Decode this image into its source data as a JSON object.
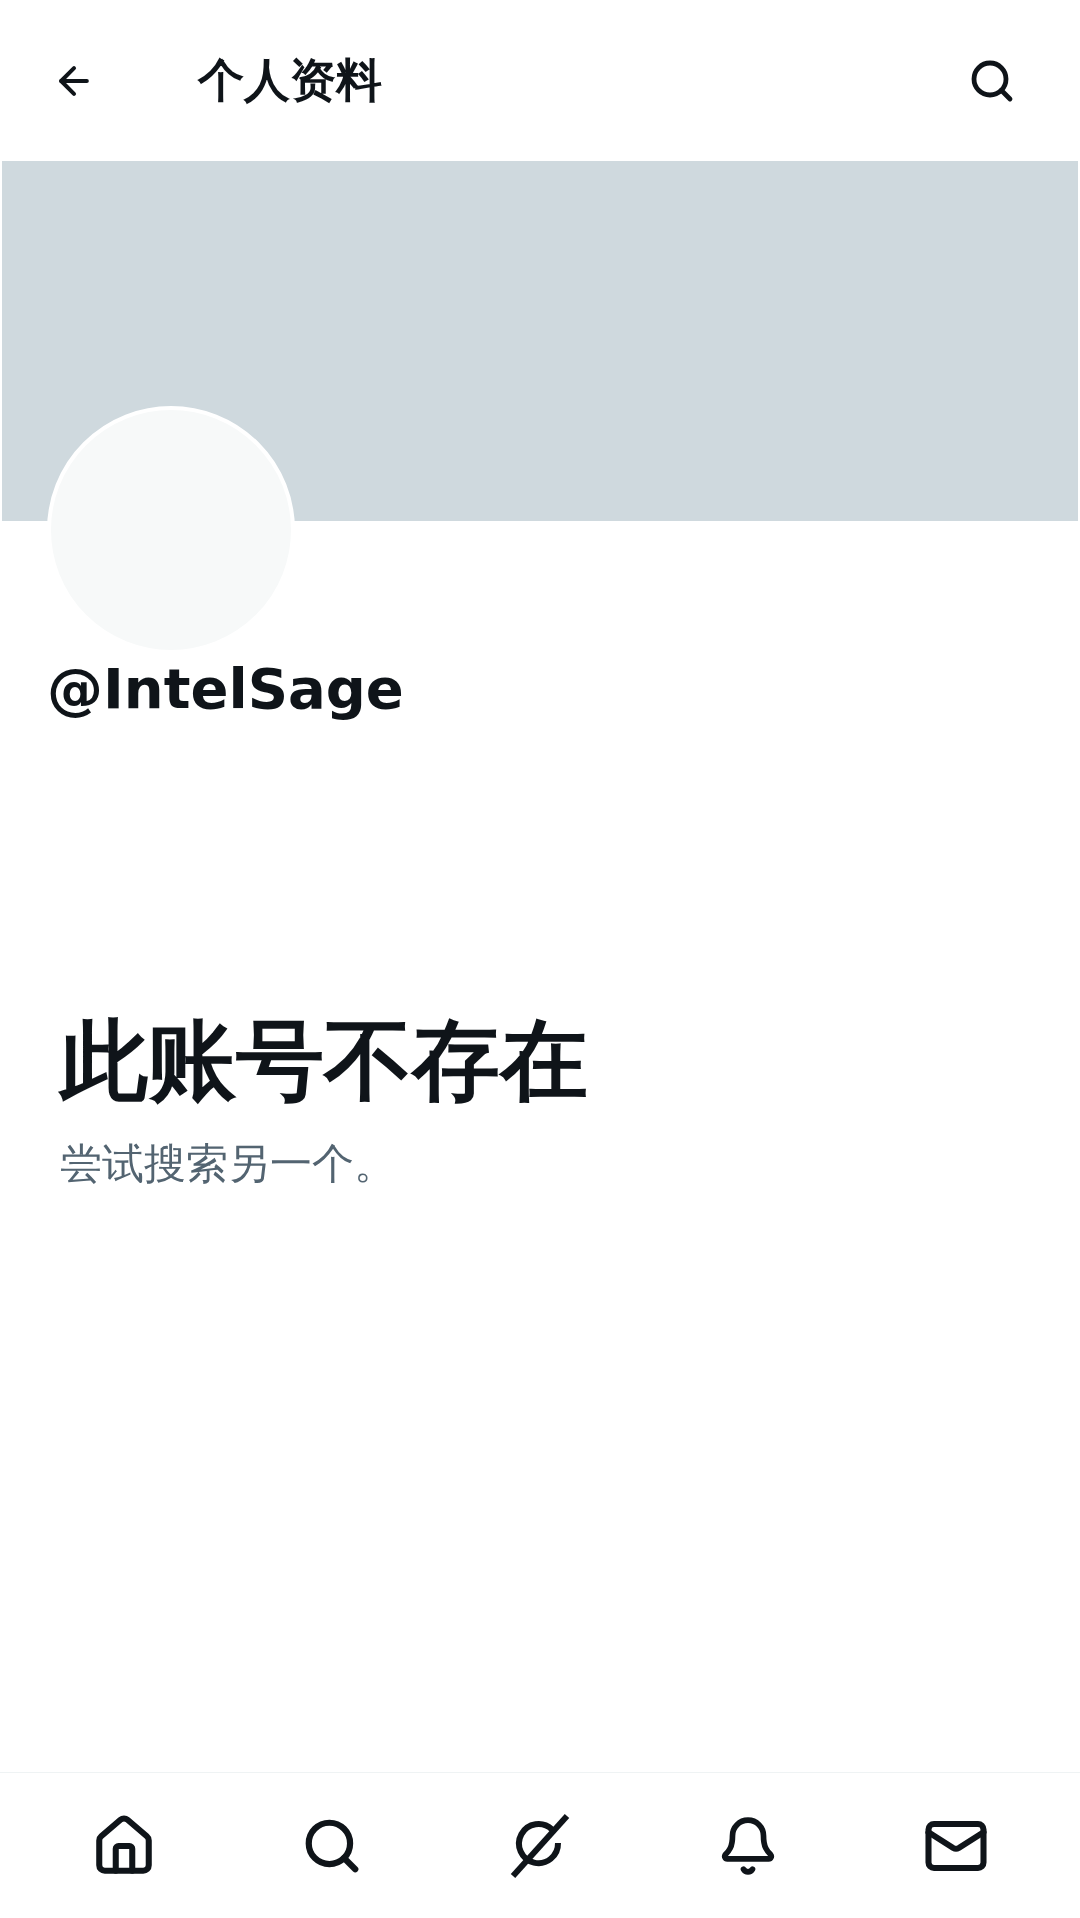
{
  "header": {
    "title": "个人资料"
  },
  "profile": {
    "handle": "@IntelSage"
  },
  "message": {
    "title": "此账号不存在",
    "subtitle": "尝试搜索另一个。"
  }
}
